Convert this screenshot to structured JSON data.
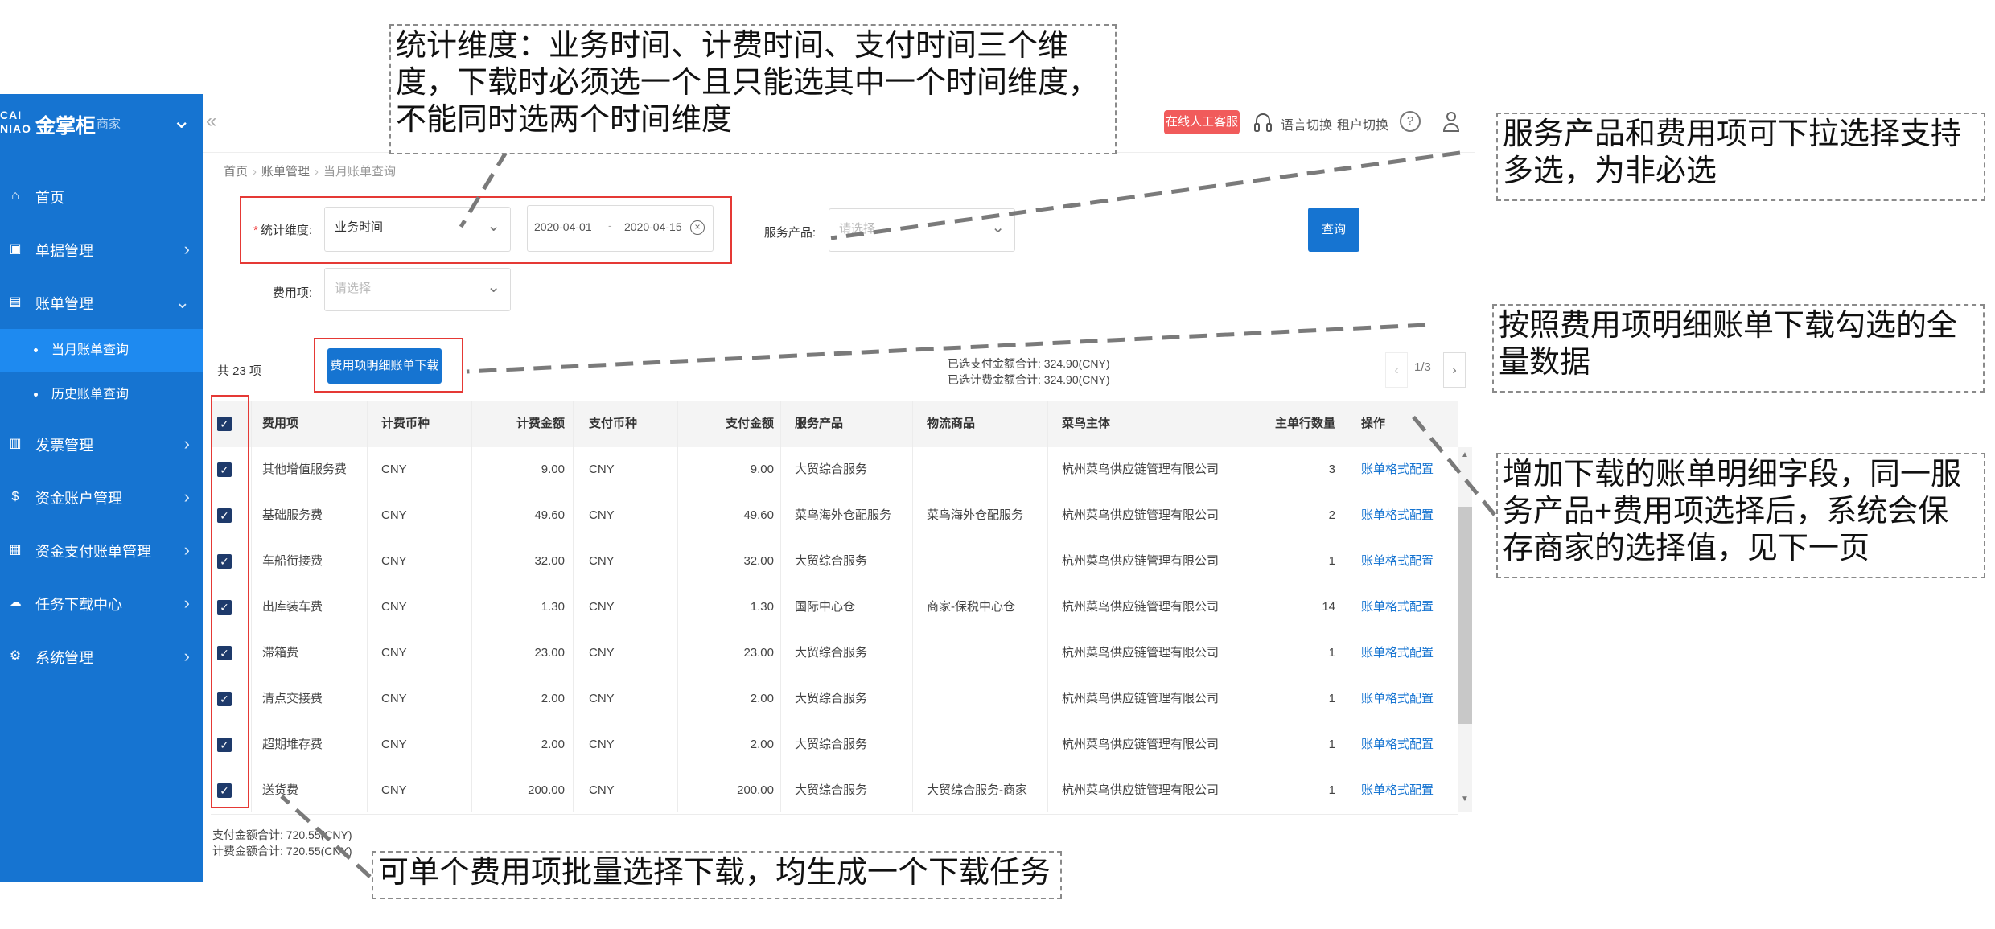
{
  "app": {
    "logo_mark": "CAI NIAO",
    "name": "金掌柜",
    "sub": "商家"
  },
  "sidebar": {
    "items": [
      {
        "label": "首页"
      },
      {
        "label": "单据管理"
      },
      {
        "label": "账单管理"
      },
      {
        "label": "发票管理"
      },
      {
        "label": "资金账户管理"
      },
      {
        "label": "资金支付账单管理"
      },
      {
        "label": "任务下载中心"
      },
      {
        "label": "系统管理"
      }
    ],
    "subitems": [
      {
        "label": "当月账单查询"
      },
      {
        "label": "历史账单查询"
      }
    ]
  },
  "header": {
    "online_service": "在线人工客服",
    "lang_switch": "语言切换",
    "tenant_switch": "租户切换",
    "help": "?"
  },
  "breadcrumb": {
    "home": "首页",
    "level1": "账单管理",
    "current": "当月账单查询"
  },
  "filters": {
    "dimension_label": "统计维度:",
    "dimension_value": "业务时间",
    "date_start": "2020-04-01",
    "date_sep": "-",
    "date_end": "2020-04-15",
    "product_label": "服务产品:",
    "product_placeholder": "请选择",
    "fee_label": "费用项:",
    "fee_placeholder": "请选择",
    "query_button": "查询"
  },
  "toolbar": {
    "total": "共 23 项",
    "download_button": "费用项明细账单下载",
    "selected_pay_sum": "已选支付金额合计: 324.90(CNY)",
    "selected_fee_sum": "已选计费金额合计: 324.90(CNY)",
    "pager_prev": "‹",
    "pager_text": "1/3",
    "pager_next": "›"
  },
  "table": {
    "headers": [
      "费用项",
      "计费币种",
      "计费金额",
      "支付币种",
      "支付金额",
      "服务产品",
      "物流商品",
      "菜鸟主体",
      "主单行数量",
      "操作"
    ],
    "rows": [
      [
        "其他增值服务费",
        "CNY",
        "9.00",
        "CNY",
        "9.00",
        "大贸综合服务",
        "",
        "杭州菜鸟供应链管理有限公司",
        "3",
        "账单格式配置"
      ],
      [
        "基础服务费",
        "CNY",
        "49.60",
        "CNY",
        "49.60",
        "菜鸟海外仓配服务",
        "菜鸟海外仓配服务",
        "杭州菜鸟供应链管理有限公司",
        "2",
        "账单格式配置"
      ],
      [
        "车船衔接费",
        "CNY",
        "32.00",
        "CNY",
        "32.00",
        "大贸综合服务",
        "",
        "杭州菜鸟供应链管理有限公司",
        "1",
        "账单格式配置"
      ],
      [
        "出库装车费",
        "CNY",
        "1.30",
        "CNY",
        "1.30",
        "国际中心仓",
        "商家-保税中心仓",
        "杭州菜鸟供应链管理有限公司",
        "14",
        "账单格式配置"
      ],
      [
        "滞箱费",
        "CNY",
        "23.00",
        "CNY",
        "23.00",
        "大贸综合服务",
        "",
        "杭州菜鸟供应链管理有限公司",
        "1",
        "账单格式配置"
      ],
      [
        "清点交接费",
        "CNY",
        "2.00",
        "CNY",
        "2.00",
        "大贸综合服务",
        "",
        "杭州菜鸟供应链管理有限公司",
        "1",
        "账单格式配置"
      ],
      [
        "超期堆存费",
        "CNY",
        "2.00",
        "CNY",
        "2.00",
        "大贸综合服务",
        "",
        "杭州菜鸟供应链管理有限公司",
        "1",
        "账单格式配置"
      ],
      [
        "送货费",
        "CNY",
        "200.00",
        "CNY",
        "200.00",
        "大贸综合服务",
        "大贸综合服务-商家",
        "杭州菜鸟供应链管理有限公司",
        "1",
        "账单格式配置"
      ]
    ]
  },
  "footer": {
    "pay_total": "支付金额合计: 720.55(CNY)",
    "fee_total": "计费金额合计: 720.55(CNY)"
  },
  "annotations": {
    "dimension_note": "统计维度：业务时间、计费时间、支付时间三个维度，下载时必须选一个且只能选其中一个时间维度，不能同时选两个时间维度",
    "product_note": "服务产品和费用项可下拉选择支持多选，为非必选",
    "download_note": "按照费用项明细账单下载勾选的全量数据",
    "config_note": "增加下载的账单明细字段，同一服务产品+费用项选择后，系统会保存商家的选择值，见下一页",
    "batch_note": "可单个费用项批量选择下载，均生成一个下载任务"
  },
  "colors": {
    "primary": "#1674d1",
    "annotation_red": "#e53935",
    "service_badge": "#f15b5b"
  }
}
